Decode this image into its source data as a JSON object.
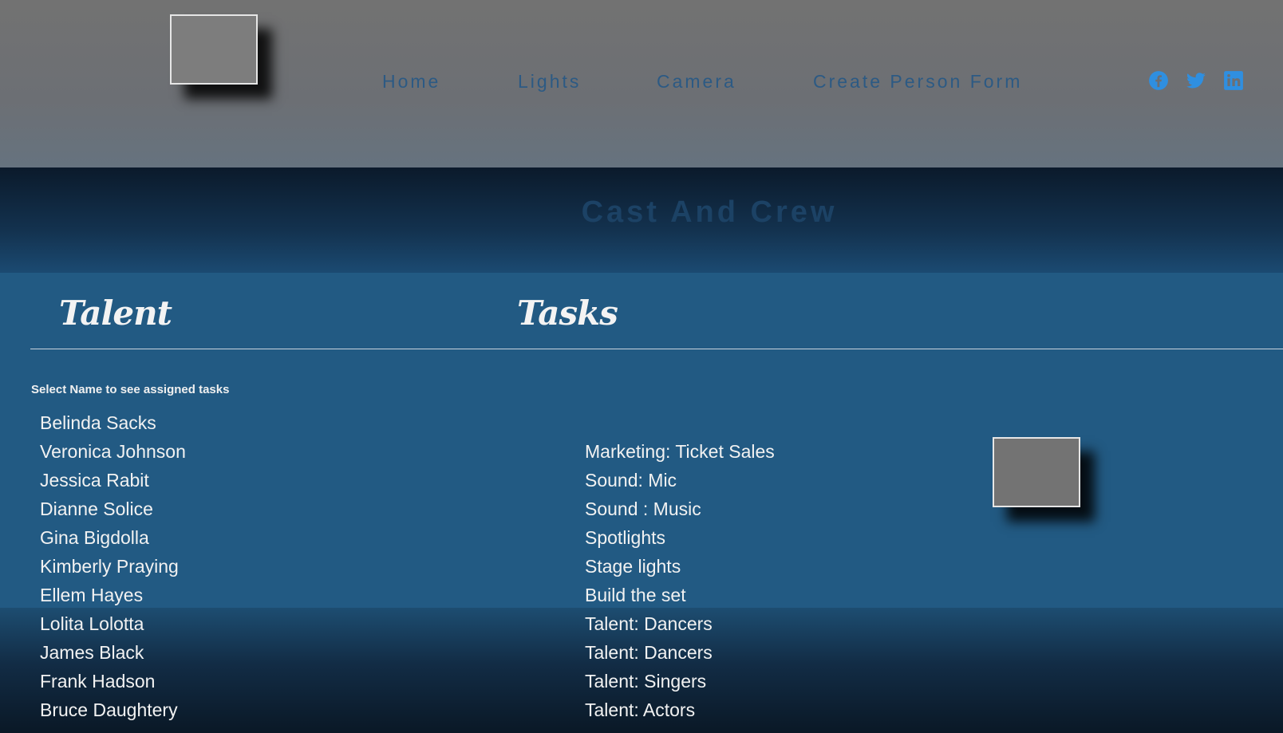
{
  "header": {
    "nav": [
      {
        "label": "Home"
      },
      {
        "label": "Lights"
      },
      {
        "label": "Camera"
      },
      {
        "label": "Create Person Form"
      }
    ],
    "social": [
      "facebook-icon",
      "twitter-icon",
      "linkedin-icon"
    ],
    "icon_color": "#2f8fe0",
    "nav_color": "#2c5a84"
  },
  "banner": {
    "title": "Cast And Crew"
  },
  "main": {
    "talent_heading": "Talent",
    "tasks_heading": "Tasks",
    "hint": "Select Name to see assigned tasks",
    "names": [
      "Belinda Sacks",
      "Veronica Johnson",
      "Jessica Rabit",
      "Dianne Solice",
      "Gina Bigdolla",
      "Kimberly Praying",
      "Ellem Hayes",
      "Lolita Lolotta",
      "James Black",
      "Frank Hadson",
      "Bruce Daughtery"
    ],
    "tasks": [
      "Marketing: Ticket Sales",
      "Sound: Mic",
      "Sound : Music",
      "Spotlights",
      "Stage lights",
      "Build the set",
      "Talent: Dancers",
      "Talent: Dancers",
      "Talent: Singers",
      "Talent: Actors"
    ],
    "background": "#225a83"
  }
}
